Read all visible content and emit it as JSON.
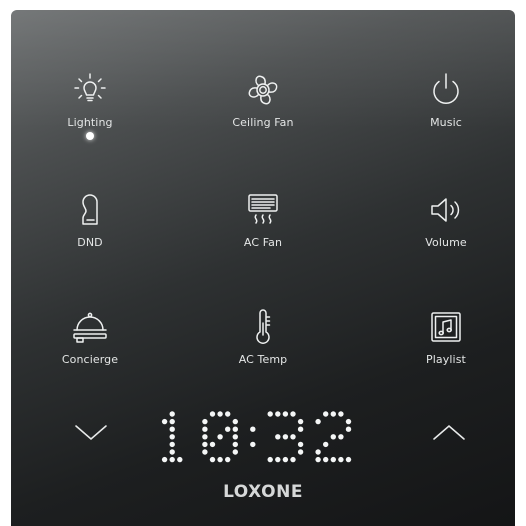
{
  "buttons": {
    "lighting": {
      "label": "Lighting",
      "icon": "lightbulb-icon",
      "active": true
    },
    "ceiling_fan": {
      "label": "Ceiling Fan",
      "icon": "fan-icon"
    },
    "music": {
      "label": "Music",
      "icon": "power-icon"
    },
    "dnd": {
      "label": "DND",
      "icon": "door-hanger-icon"
    },
    "ac_fan": {
      "label": "AC Fan",
      "icon": "air-conditioner-icon"
    },
    "volume": {
      "label": "Volume",
      "icon": "speaker-icon"
    },
    "concierge": {
      "label": "Concierge",
      "icon": "cloche-icon"
    },
    "ac_temp": {
      "label": "AC Temp",
      "icon": "thermometer-icon"
    },
    "playlist": {
      "label": "Playlist",
      "icon": "music-note-icon"
    }
  },
  "controls": {
    "down": {
      "icon": "chevron-down-icon"
    },
    "up": {
      "icon": "chevron-up-icon"
    }
  },
  "display": {
    "time": "10:32"
  },
  "brand": "LOXONE",
  "colors": {
    "panel_top": "#6b6e6f",
    "panel_bottom": "#141516",
    "icon": "#eef0f0",
    "indicator": "#ffffff"
  }
}
